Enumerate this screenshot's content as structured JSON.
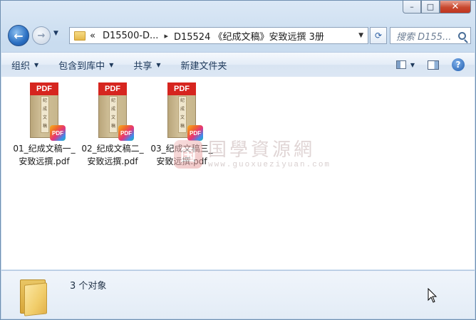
{
  "window": {
    "caption": {
      "minimize": "–",
      "maximize": "□",
      "close": "✕"
    }
  },
  "nav": {
    "back_glyph": "←",
    "forward_glyph": "→",
    "dropdown_glyph": "▼",
    "address_overflow": "«",
    "breadcrumb": [
      "D15500-D...",
      "D15524 《纪成文稿》安致远撰 3册"
    ],
    "breadcrumb_sep": "▸",
    "address_dropdown": "▼",
    "refresh_glyph": "⟳",
    "search_placeholder": "搜索 D155..."
  },
  "toolbar": {
    "items": [
      {
        "label": "组织",
        "has_menu": true
      },
      {
        "label": "包含到库中",
        "has_menu": true
      },
      {
        "label": "共享",
        "has_menu": true
      },
      {
        "label": "新建文件夹",
        "has_menu": false
      }
    ],
    "menu_arrow": "▼",
    "view_arrow": "▼",
    "help_glyph": "?"
  },
  "files": [
    {
      "line1": "01_纪成文稿一_",
      "line2": "安致远撰.pdf",
      "cover": [
        "纪",
        "成",
        "文",
        "稿"
      ]
    },
    {
      "line1": "02_纪成文稿二_",
      "line2": "安致远撰.pdf",
      "cover": [
        "纪",
        "成",
        "文",
        "稿"
      ]
    },
    {
      "line1": "03_纪成文稿三_",
      "line2": "安致远撰.pdf",
      "cover": [
        "纪",
        "成",
        "文",
        "稿"
      ]
    }
  ],
  "file_icon": {
    "band_text": "PDF",
    "badge_text": "PDF",
    "band_color": "#d6251f"
  },
  "watermark": {
    "logo": "国",
    "text": "国學資源網",
    "url": "www.guoxueziyuan.com"
  },
  "details": {
    "count_text": "3 个对象"
  }
}
